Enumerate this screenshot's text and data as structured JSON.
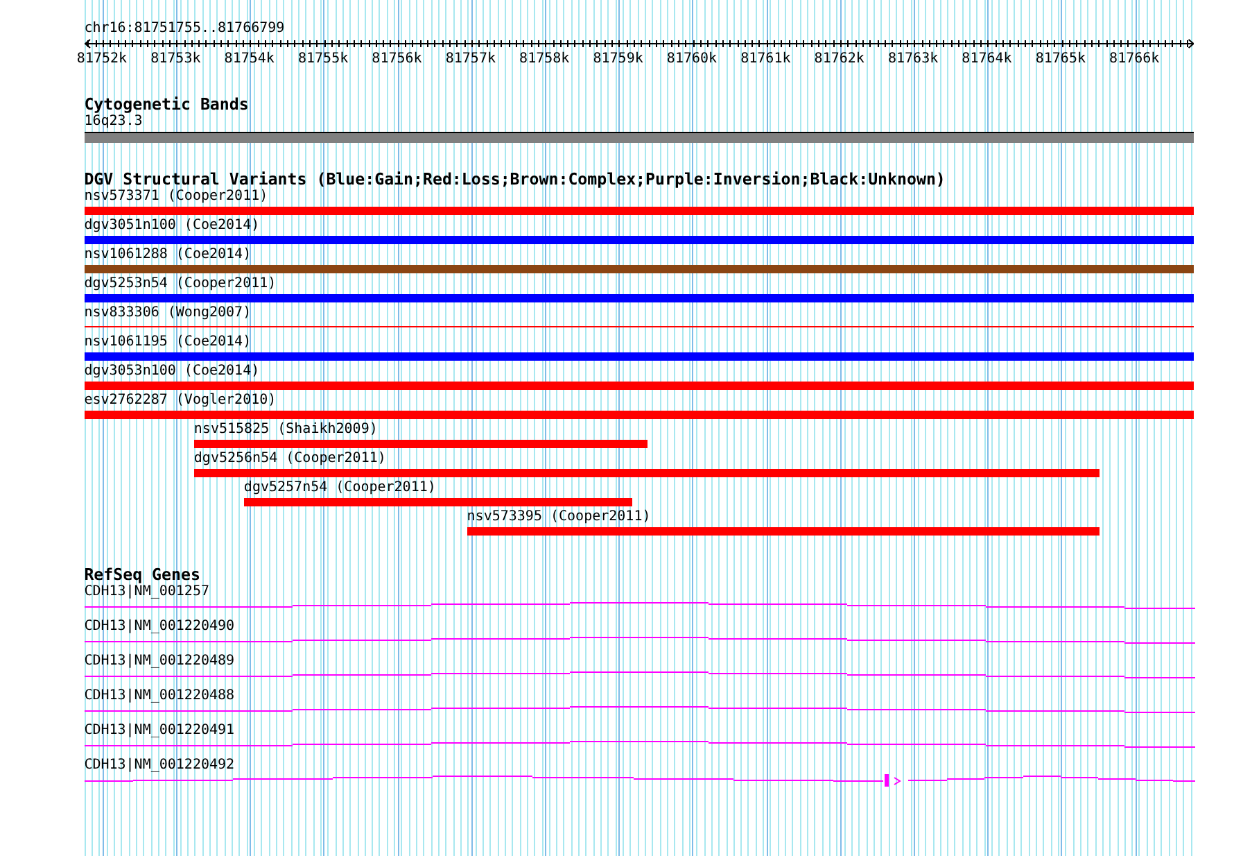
{
  "locus": "chr16:81751755..81766799",
  "ruler": {
    "ticks": [
      "81752k",
      "81753k",
      "81754k",
      "81755k",
      "81756k",
      "81757k",
      "81758k",
      "81759k",
      "81760k",
      "81761k",
      "81762k",
      "81763k",
      "81764k",
      "81765k",
      "81766k"
    ]
  },
  "cytogenetic_bands": {
    "title": "Cytogenetic Bands",
    "band": "16q23.3"
  },
  "structural_variants": {
    "title": "DGV Structural Variants (Blue:Gain;Red:Loss;Brown:Complex;Purple:Inversion;Black:Unknown)",
    "variants": [
      {
        "name": "nsv573371 (Cooper2011)",
        "color": "#ff0000",
        "kind": "bar"
      },
      {
        "name": "dgv3051n100 (Coe2014)",
        "color": "#0000ff",
        "kind": "bar"
      },
      {
        "name": "nsv1061288 (Coe2014)",
        "color": "#8b4513",
        "kind": "bar"
      },
      {
        "name": "dgv5253n54 (Cooper2011)",
        "color": "#0000ff",
        "kind": "bar"
      },
      {
        "name": "nsv833306 (Wong2007)",
        "color": "#ff0000",
        "kind": "line"
      },
      {
        "name": "nsv1061195 (Coe2014)",
        "color": "#0000ff",
        "kind": "bar"
      },
      {
        "name": "dgv3053n100 (Coe2014)",
        "color": "#ff0000",
        "kind": "bar"
      },
      {
        "name": "esv2762287 (Vogler2010)",
        "color": "#ff0000",
        "kind": "bar"
      },
      {
        "name": "nsv515825 (Shaikh2009)",
        "color": "#ff0000",
        "kind": "bar"
      },
      {
        "name": "dgv5256n54 (Cooper2011)",
        "color": "#ff0000",
        "kind": "bar"
      },
      {
        "name": "dgv5257n54 (Cooper2011)",
        "color": "#ff0000",
        "kind": "bar"
      },
      {
        "name": "nsv573395 (Cooper2011)",
        "color": "#ff0000",
        "kind": "bar"
      }
    ]
  },
  "refseq_genes": {
    "title": "RefSeq Genes",
    "genes": [
      {
        "name": "CDH13|NM_001257"
      },
      {
        "name": "CDH13|NM_001220490"
      },
      {
        "name": "CDH13|NM_001220489"
      },
      {
        "name": "CDH13|NM_001220488"
      },
      {
        "name": "CDH13|NM_001220491"
      },
      {
        "name": "CDH13|NM_001220492"
      }
    ]
  }
}
